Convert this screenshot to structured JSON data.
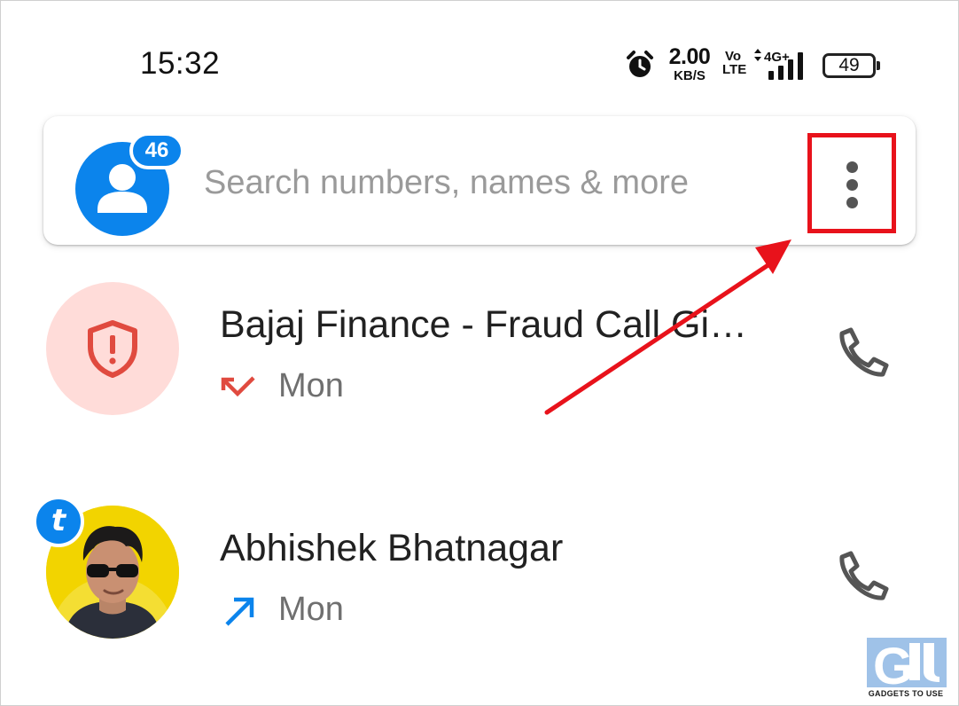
{
  "status_bar": {
    "time": "15:32",
    "net_speed_value": "2.00",
    "net_speed_unit": "KB/S",
    "volte_top": "Vo",
    "volte_bottom": "LTE",
    "network_label": "4G+",
    "battery_level": "49",
    "icons": [
      "alarm-icon",
      "signal-icon",
      "battery-icon"
    ]
  },
  "search": {
    "placeholder": "Search numbers, names & more",
    "notification_count": "46",
    "avatar_icon": "person-icon",
    "menu_icon": "more-vert-icon"
  },
  "calls": [
    {
      "name": "Bajaj Finance - Fraud Call Gi…",
      "time": "Mon",
      "direction": "missed",
      "avatar_icon": "shield-alert-icon",
      "avatar_color": "#ffdcd9",
      "direction_color": "#e04a3f"
    },
    {
      "name": "Abhishek Bhatnagar",
      "time": "Mon",
      "direction": "outgoing",
      "avatar_icon": "contact-photo",
      "badge": "t",
      "direction_color": "#0b84ec"
    }
  ],
  "colors": {
    "accent": "#0b84ec",
    "highlight": "#e8121b",
    "secondary_text": "#6f6f6f"
  },
  "watermark": {
    "logo": "G",
    "text": "GADGETS TO USE"
  }
}
